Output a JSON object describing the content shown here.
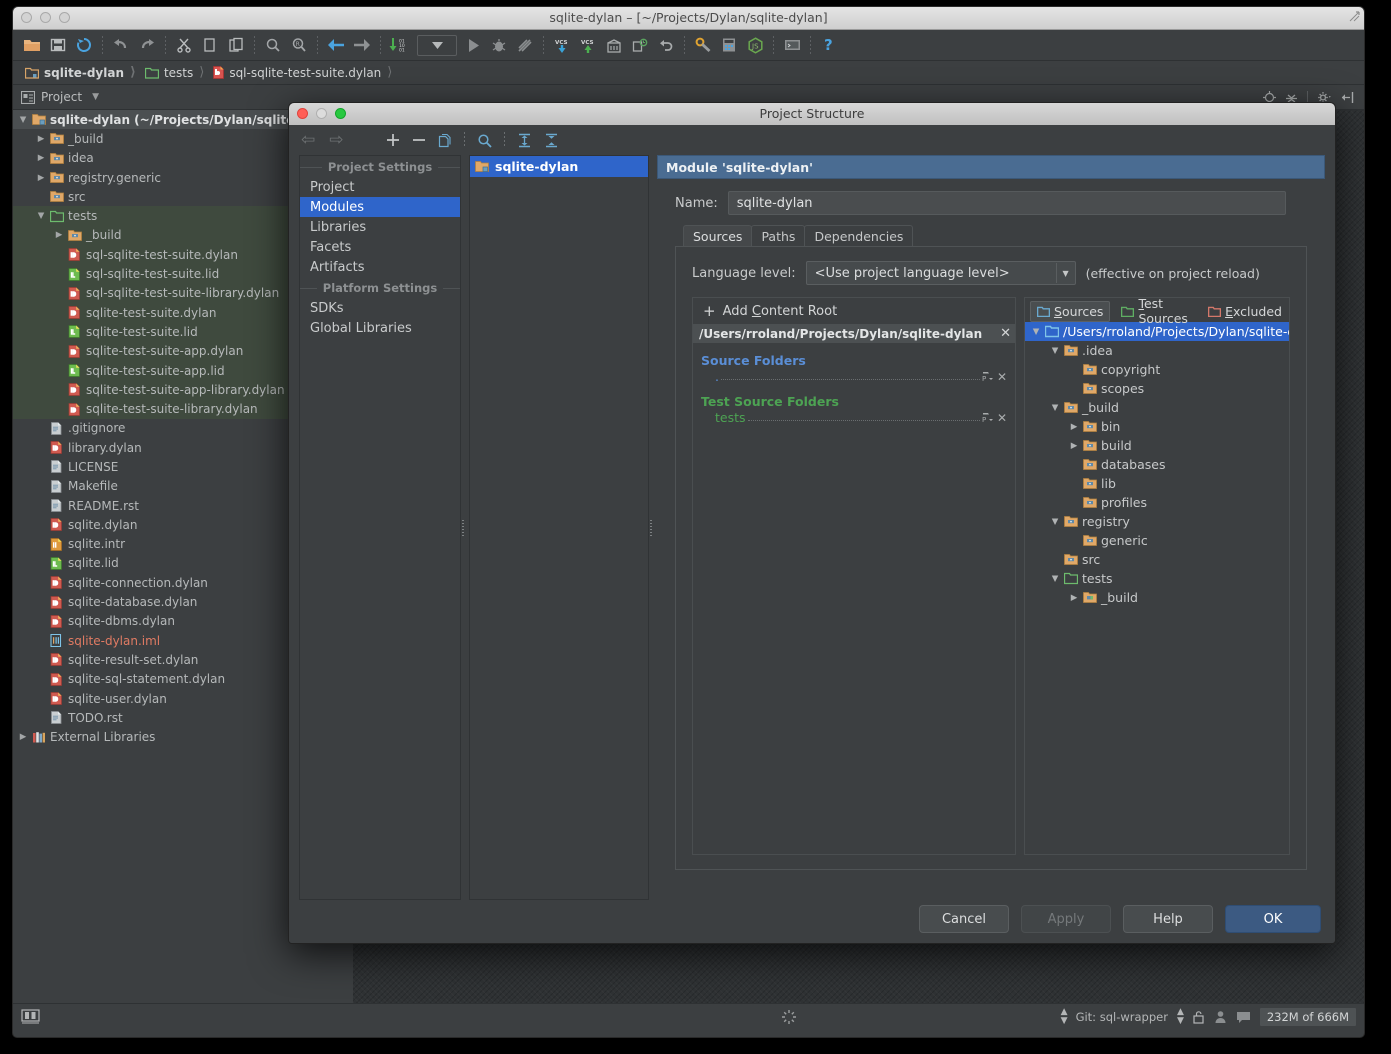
{
  "window": {
    "title": "sqlite-dylan – [~/Projects/Dylan/sqlite-dylan]",
    "traffic_lights": [
      "close",
      "minimize",
      "zoom"
    ]
  },
  "toolbar": {
    "buttons": [
      {
        "name": "open-project-icon",
        "glyph": "folder"
      },
      {
        "name": "save-all-icon",
        "glyph": "save"
      },
      {
        "name": "sync-icon",
        "glyph": "sync"
      },
      {
        "name": "undo-icon",
        "glyph": "undo"
      },
      {
        "name": "redo-icon",
        "glyph": "redo"
      },
      {
        "name": "cut-icon",
        "glyph": "cut"
      },
      {
        "name": "copy-icon",
        "glyph": "copy"
      },
      {
        "name": "paste-icon",
        "glyph": "paste"
      },
      {
        "name": "find-icon",
        "glyph": "find"
      },
      {
        "name": "replace-icon",
        "glyph": "replace"
      },
      {
        "name": "back-icon",
        "glyph": "back"
      },
      {
        "name": "forward-icon",
        "glyph": "forward"
      },
      {
        "name": "compile-icon",
        "glyph": "compile"
      },
      {
        "name": "run-config-dropdown",
        "glyph": "dropdown"
      },
      {
        "name": "run-icon",
        "glyph": "run"
      },
      {
        "name": "debug-icon",
        "glyph": "debug"
      },
      {
        "name": "coverage-icon",
        "glyph": "coverage"
      },
      {
        "name": "vcs-update-icon",
        "glyph": "vcs-down"
      },
      {
        "name": "vcs-commit-icon",
        "glyph": "vcs-up"
      },
      {
        "name": "vcs-history-icon",
        "glyph": "history"
      },
      {
        "name": "vcs-diff-icon",
        "glyph": "diff"
      },
      {
        "name": "vcs-revert-icon",
        "glyph": "revert"
      },
      {
        "name": "settings-icon",
        "glyph": "wrench"
      },
      {
        "name": "project-structure-icon",
        "glyph": "structure"
      },
      {
        "name": "javascript-icon",
        "glyph": "js"
      },
      {
        "name": "terminal-icon",
        "glyph": "terminal"
      },
      {
        "name": "help-icon",
        "glyph": "help"
      }
    ]
  },
  "breadcrumb": {
    "items": [
      {
        "label": "sqlite-dylan",
        "icon": "module-folder-icon",
        "bold": true
      },
      {
        "label": "tests",
        "icon": "test-folder-icon",
        "bold": false
      },
      {
        "label": "sql-sqlite-test-suite.dylan",
        "icon": "dylan-file-icon",
        "bold": false
      }
    ]
  },
  "project_panel": {
    "title": "Project",
    "icons": [
      "project-view-icon",
      "collapse-caret-icon",
      "locate-icon",
      "collapse-all-icon",
      "gear-icon",
      "hide-icon"
    ]
  },
  "project_tree": [
    {
      "depth": 0,
      "arrow": "down",
      "icon": "module-folder-icon",
      "label": "sqlite-dylan (~/Projects/Dylan/sqlite-dylan)",
      "bold": true,
      "style": "root-selected"
    },
    {
      "depth": 1,
      "arrow": "right",
      "icon": "folder-icon",
      "label": "_build",
      "bold": false,
      "style": ""
    },
    {
      "depth": 1,
      "arrow": "right",
      "icon": "folder-icon",
      "label": "idea",
      "bold": false,
      "style": ""
    },
    {
      "depth": 1,
      "arrow": "right",
      "icon": "folder-icon",
      "label": "registry.generic",
      "bold": false,
      "style": ""
    },
    {
      "depth": 1,
      "arrow": "none",
      "icon": "folder-icon",
      "label": "src",
      "bold": false,
      "style": ""
    },
    {
      "depth": 1,
      "arrow": "down",
      "icon": "test-folder-icon",
      "label": "tests",
      "bold": false,
      "style": "test-source"
    },
    {
      "depth": 2,
      "arrow": "right",
      "icon": "folder-icon",
      "label": "_build",
      "bold": false,
      "style": "test-source"
    },
    {
      "depth": 2,
      "arrow": "none",
      "icon": "dylan-file-icon",
      "label": "sql-sqlite-test-suite.dylan",
      "bold": false,
      "style": "test-source"
    },
    {
      "depth": 2,
      "arrow": "none",
      "icon": "lid-file-icon",
      "label": "sql-sqlite-test-suite.lid",
      "bold": false,
      "style": "test-source"
    },
    {
      "depth": 2,
      "arrow": "none",
      "icon": "dylan-file-icon",
      "label": "sql-sqlite-test-suite-library.dylan",
      "bold": false,
      "style": "test-source"
    },
    {
      "depth": 2,
      "arrow": "none",
      "icon": "dylan-file-icon",
      "label": "sqlite-test-suite.dylan",
      "bold": false,
      "style": "test-source"
    },
    {
      "depth": 2,
      "arrow": "none",
      "icon": "lid-file-icon",
      "label": "sqlite-test-suite.lid",
      "bold": false,
      "style": "test-source"
    },
    {
      "depth": 2,
      "arrow": "none",
      "icon": "dylan-file-icon",
      "label": "sqlite-test-suite-app.dylan",
      "bold": false,
      "style": "test-source"
    },
    {
      "depth": 2,
      "arrow": "none",
      "icon": "lid-file-icon",
      "label": "sqlite-test-suite-app.lid",
      "bold": false,
      "style": "test-source"
    },
    {
      "depth": 2,
      "arrow": "none",
      "icon": "dylan-file-icon",
      "label": "sqlite-test-suite-app-library.dylan",
      "bold": false,
      "style": "test-source"
    },
    {
      "depth": 2,
      "arrow": "none",
      "icon": "dylan-file-icon",
      "label": "sqlite-test-suite-library.dylan",
      "bold": false,
      "style": "test-source"
    },
    {
      "depth": 1,
      "arrow": "none",
      "icon": "text-file-icon",
      "label": ".gitignore",
      "bold": false,
      "style": ""
    },
    {
      "depth": 1,
      "arrow": "none",
      "icon": "dylan-file-icon",
      "label": "library.dylan",
      "bold": false,
      "style": ""
    },
    {
      "depth": 1,
      "arrow": "none",
      "icon": "text-file-icon",
      "label": "LICENSE",
      "bold": false,
      "style": ""
    },
    {
      "depth": 1,
      "arrow": "none",
      "icon": "text-file-icon",
      "label": "Makefile",
      "bold": false,
      "style": ""
    },
    {
      "depth": 1,
      "arrow": "none",
      "icon": "text-file-icon",
      "label": "README.rst",
      "bold": false,
      "style": ""
    },
    {
      "depth": 1,
      "arrow": "none",
      "icon": "dylan-file-icon",
      "label": "sqlite.dylan",
      "bold": false,
      "style": ""
    },
    {
      "depth": 1,
      "arrow": "none",
      "icon": "intr-file-icon",
      "label": "sqlite.intr",
      "bold": false,
      "style": ""
    },
    {
      "depth": 1,
      "arrow": "none",
      "icon": "lid-file-icon",
      "label": "sqlite.lid",
      "bold": false,
      "style": ""
    },
    {
      "depth": 1,
      "arrow": "none",
      "icon": "dylan-file-icon",
      "label": "sqlite-connection.dylan",
      "bold": false,
      "style": ""
    },
    {
      "depth": 1,
      "arrow": "none",
      "icon": "dylan-file-icon",
      "label": "sqlite-database.dylan",
      "bold": false,
      "style": ""
    },
    {
      "depth": 1,
      "arrow": "none",
      "icon": "dylan-file-icon",
      "label": "sqlite-dbms.dylan",
      "bold": false,
      "style": ""
    },
    {
      "depth": 1,
      "arrow": "none",
      "icon": "iml-file-icon",
      "label": "sqlite-dylan.iml",
      "bold": false,
      "style": "iml"
    },
    {
      "depth": 1,
      "arrow": "none",
      "icon": "dylan-file-icon",
      "label": "sqlite-result-set.dylan",
      "bold": false,
      "style": ""
    },
    {
      "depth": 1,
      "arrow": "none",
      "icon": "dylan-file-icon",
      "label": "sqlite-sql-statement.dylan",
      "bold": false,
      "style": ""
    },
    {
      "depth": 1,
      "arrow": "none",
      "icon": "dylan-file-icon",
      "label": "sqlite-user.dylan",
      "bold": false,
      "style": ""
    },
    {
      "depth": 1,
      "arrow": "none",
      "icon": "text-file-icon",
      "label": "TODO.rst",
      "bold": false,
      "style": ""
    },
    {
      "depth": 0,
      "arrow": "right",
      "icon": "external-libraries-icon",
      "label": "External Libraries",
      "bold": false,
      "style": ""
    }
  ],
  "status_bar": {
    "vcs_label": "Git: sql-wrapper",
    "memory": "232M of 666M",
    "icons": [
      "editor-layout-icon",
      "background-tasks-icon",
      "vcs-chooser-icon",
      "lock-icon",
      "user-icon",
      "event-log-icon"
    ]
  },
  "dialog": {
    "title": "Project Structure",
    "toolbar_icons": [
      "back-arrow-icon",
      "forward-arrow-icon"
    ],
    "module_toolbar_icons": [
      "add-icon",
      "remove-icon",
      "copy-icon",
      "search-icon",
      "expand-all-icon",
      "collapse-all-icon"
    ],
    "sidebar": {
      "groups": [
        {
          "title": "Project Settings",
          "items": [
            {
              "label": "Project",
              "active": false
            },
            {
              "label": "Modules",
              "active": true
            },
            {
              "label": "Libraries",
              "active": false
            },
            {
              "label": "Facets",
              "active": false
            },
            {
              "label": "Artifacts",
              "active": false
            }
          ]
        },
        {
          "title": "Platform Settings",
          "items": [
            {
              "label": "SDKs",
              "active": false
            },
            {
              "label": "Global Libraries",
              "active": false
            }
          ]
        }
      ]
    },
    "modules_list": [
      {
        "label": "sqlite-dylan",
        "icon": "module-folder-icon",
        "selected": true
      }
    ],
    "module": {
      "header": "Module 'sqlite-dylan'",
      "name_label": "Name:",
      "name_value": "sqlite-dylan",
      "tabs": [
        {
          "label": "Sources",
          "active": true
        },
        {
          "label": "Paths",
          "active": false
        },
        {
          "label": "Dependencies",
          "active": false
        }
      ],
      "language_level_label": "Language level:",
      "language_level_value": "<Use project language level>",
      "language_level_note": "(effective on project reload)",
      "add_content_root": "Add Content Root",
      "content_root_path": "/Users/rroland/Projects/Dylan/sqlite-dylan",
      "source_folders_label": "Source Folders",
      "source_folders": [
        ""
      ],
      "test_source_folders_label": "Test Source Folders",
      "test_source_folders": [
        "tests"
      ],
      "marks": [
        {
          "label": "Sources",
          "mnemonic": "S",
          "active": true,
          "color": "#6aa9cf"
        },
        {
          "label": "Test Sources",
          "mnemonic": "T",
          "active": false,
          "color": "#5fae63"
        },
        {
          "label": "Excluded",
          "mnemonic": "E",
          "active": false,
          "color": "#d4786a"
        }
      ],
      "root_tree": [
        {
          "depth": 0,
          "arrow": "down",
          "icon": "content-root-icon",
          "label": "/Users/rroland/Projects/Dylan/sqlite-dylan",
          "selected": true,
          "mark": "source"
        },
        {
          "depth": 1,
          "arrow": "down",
          "icon": "folder-icon",
          "label": ".idea",
          "selected": false,
          "mark": ""
        },
        {
          "depth": 2,
          "arrow": "none",
          "icon": "folder-icon",
          "label": "copyright",
          "selected": false,
          "mark": ""
        },
        {
          "depth": 2,
          "arrow": "none",
          "icon": "folder-icon",
          "label": "scopes",
          "selected": false,
          "mark": ""
        },
        {
          "depth": 1,
          "arrow": "down",
          "icon": "folder-icon",
          "label": "_build",
          "selected": false,
          "mark": ""
        },
        {
          "depth": 2,
          "arrow": "right",
          "icon": "folder-icon",
          "label": "bin",
          "selected": false,
          "mark": ""
        },
        {
          "depth": 2,
          "arrow": "right",
          "icon": "folder-icon",
          "label": "build",
          "selected": false,
          "mark": ""
        },
        {
          "depth": 2,
          "arrow": "none",
          "icon": "folder-icon",
          "label": "databases",
          "selected": false,
          "mark": ""
        },
        {
          "depth": 2,
          "arrow": "none",
          "icon": "folder-icon",
          "label": "lib",
          "selected": false,
          "mark": ""
        },
        {
          "depth": 2,
          "arrow": "none",
          "icon": "folder-icon",
          "label": "profiles",
          "selected": false,
          "mark": ""
        },
        {
          "depth": 1,
          "arrow": "down",
          "icon": "folder-icon",
          "label": "registry",
          "selected": false,
          "mark": ""
        },
        {
          "depth": 2,
          "arrow": "none",
          "icon": "folder-icon",
          "label": "generic",
          "selected": false,
          "mark": ""
        },
        {
          "depth": 1,
          "arrow": "none",
          "icon": "folder-icon",
          "label": "src",
          "selected": false,
          "mark": ""
        },
        {
          "depth": 1,
          "arrow": "down",
          "icon": "test-folder-icon",
          "label": "tests",
          "selected": false,
          "mark": "test"
        },
        {
          "depth": 2,
          "arrow": "right",
          "icon": "mixed-folder-icon",
          "label": "_build",
          "selected": false,
          "mark": ""
        }
      ]
    },
    "buttons": [
      {
        "label": "Cancel",
        "kind": "normal"
      },
      {
        "label": "Apply",
        "kind": "disabled"
      },
      {
        "label": "Help",
        "kind": "normal"
      },
      {
        "label": "OK",
        "kind": "default"
      }
    ]
  },
  "colors": {
    "window_bg": "#3c3f41",
    "selection_blue": "#2f65ca",
    "header_blue": "#4a6c92",
    "test_source_green": "#3f4a3e",
    "source_label_blue": "#5a8ed6",
    "test_label_green": "#4da353",
    "iml_red": "#e07b63"
  }
}
